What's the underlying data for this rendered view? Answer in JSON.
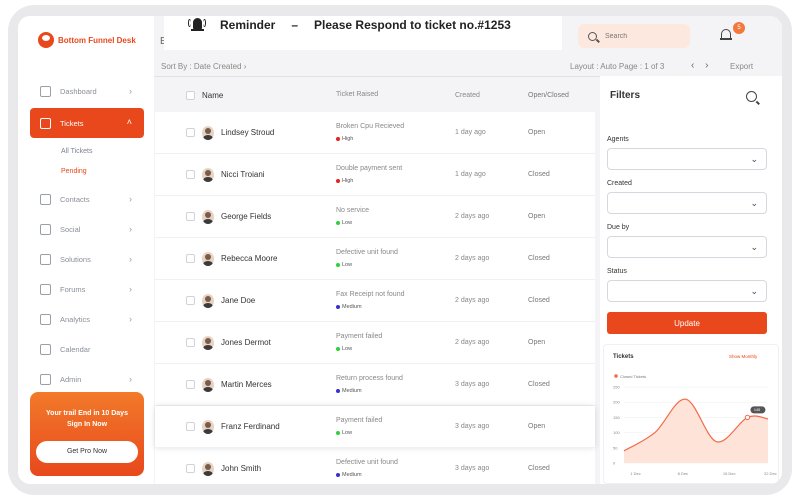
{
  "brand": {
    "name": "Bottom Funnel Desk"
  },
  "topbar": {
    "cut_char": "E",
    "search_placeholder": "Search",
    "notification_count": "5"
  },
  "reminder": {
    "label": "Reminder",
    "dash": "–",
    "message": "Please Respond to ticket no.#1253"
  },
  "sidebar": {
    "items": [
      {
        "label": "Dashboard",
        "icon": "dashboard-icon",
        "chevron": "›"
      },
      {
        "label": "Tickets",
        "icon": "ticket-icon",
        "chevron": "˄",
        "active": true,
        "sub": [
          {
            "label": "All Tickets"
          },
          {
            "label": "Pending",
            "current": true
          }
        ]
      },
      {
        "label": "Contacts",
        "icon": "contacts-icon",
        "chevron": "›"
      },
      {
        "label": "Social",
        "icon": "social-icon",
        "chevron": "›"
      },
      {
        "label": "Solutions",
        "icon": "solutions-icon",
        "chevron": "›"
      },
      {
        "label": "Forums",
        "icon": "forums-icon",
        "chevron": "›"
      },
      {
        "label": "Analytics",
        "icon": "analytics-icon",
        "chevron": "›"
      },
      {
        "label": "Calendar",
        "icon": "calendar-icon",
        "chevron": ""
      },
      {
        "label": "Admin",
        "icon": "admin-icon",
        "chevron": "›"
      }
    ],
    "promo": {
      "text": "Your trail End in 10 Days Sign In Now",
      "button": "Get Pro Now"
    }
  },
  "toolbar": {
    "sort": "Sort By : Date Created ›",
    "layout": "Layout : Auto   Page : 1 of 3",
    "prev": "‹",
    "next": "›",
    "export": "Export"
  },
  "table": {
    "columns": {
      "name": "Name",
      "ticket": "Ticket Raised",
      "created": "Created",
      "status": "Open/Closed"
    },
    "rows": [
      {
        "name": "Lindsey Stroud",
        "ticket": "Broken Cpu Recieved",
        "priority": "High",
        "priority_color": "#e0261b",
        "created": "1 day ago",
        "status": "Open"
      },
      {
        "name": "Nicci Troiani",
        "ticket": "Double payment sent",
        "priority": "High",
        "priority_color": "#e0261b",
        "created": "1 day ago",
        "status": "Closed"
      },
      {
        "name": "George Fields",
        "ticket": "No service",
        "priority": "Low",
        "priority_color": "#2fd13a",
        "created": "2 days ago",
        "status": "Open"
      },
      {
        "name": "Rebecca Moore",
        "ticket": "Defective unit found",
        "priority": "Low",
        "priority_color": "#2fd13a",
        "created": "2 days ago",
        "status": "Closed"
      },
      {
        "name": "Jane Doe",
        "ticket": "Fax Receipt not found",
        "priority": "Medium",
        "priority_color": "#3a2fd1",
        "created": "2 days ago",
        "status": "Closed"
      },
      {
        "name": "Jones Dermot",
        "ticket": "Payment failed",
        "priority": "Low",
        "priority_color": "#2fd13a",
        "created": "2 days ago",
        "status": "Open"
      },
      {
        "name": "Martin Merces",
        "ticket": "Return process found",
        "priority": "Medium",
        "priority_color": "#3a2fd1",
        "created": "3 days ago",
        "status": "Closed"
      },
      {
        "name": "Franz Ferdinand",
        "ticket": "Payment failed",
        "priority": "Low",
        "priority_color": "#2fd13a",
        "created": "3 days ago",
        "status": "Open"
      },
      {
        "name": "John Smith",
        "ticket": "Defective unit found",
        "priority": "Medium",
        "priority_color": "#3a2fd1",
        "created": "3 days ago",
        "status": "Closed"
      }
    ]
  },
  "filters": {
    "title": "Filters",
    "fields": [
      {
        "label": "Agents"
      },
      {
        "label": "Created"
      },
      {
        "label": "Due by"
      },
      {
        "label": "Status"
      }
    ],
    "update_label": "Update"
  },
  "chart_data": {
    "type": "area",
    "title": "Tickets",
    "show_label": "Show Monthly",
    "legend": [
      "Closed Tickets"
    ],
    "legend_placement": "top-left",
    "x": [
      "1 Dec",
      "8 Dec",
      "15 Dec",
      "22 Dec"
    ],
    "y_ticks": [
      0,
      50,
      100,
      150,
      200,
      250
    ],
    "ylim": [
      0,
      250
    ],
    "series": [
      {
        "name": "Closed Tickets",
        "values": [
          40,
          100,
          210,
          70,
          150,
          145
        ],
        "x_pos": [
          1,
          2.5,
          4,
          5.5,
          7,
          8
        ]
      }
    ],
    "tooltip": "145",
    "color": "#f26b4b"
  }
}
